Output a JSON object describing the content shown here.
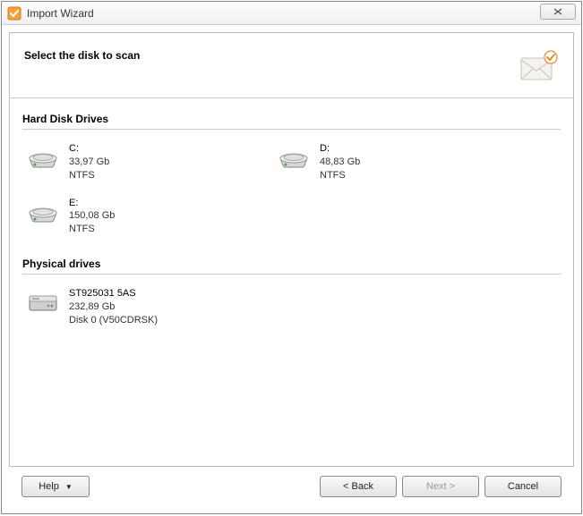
{
  "window": {
    "title": "Import Wizard"
  },
  "header": {
    "title": "Select the disk to scan"
  },
  "sections": {
    "hard_disk": {
      "title": "Hard Disk Drives",
      "drives": [
        {
          "name": "C:",
          "size": "33,97 Gb",
          "fs": "NTFS"
        },
        {
          "name": "D:",
          "size": "48,83 Gb",
          "fs": "NTFS"
        },
        {
          "name": "E:",
          "size": "150,08 Gb",
          "fs": "NTFS"
        }
      ]
    },
    "physical": {
      "title": "Physical drives",
      "drives": [
        {
          "name": "ST925031 5AS",
          "size": "232,89 Gb",
          "extra": "Disk 0 (V50CDRSK)"
        }
      ]
    }
  },
  "footer": {
    "help": "Help",
    "back": "< Back",
    "next": "Next >",
    "cancel": "Cancel"
  }
}
